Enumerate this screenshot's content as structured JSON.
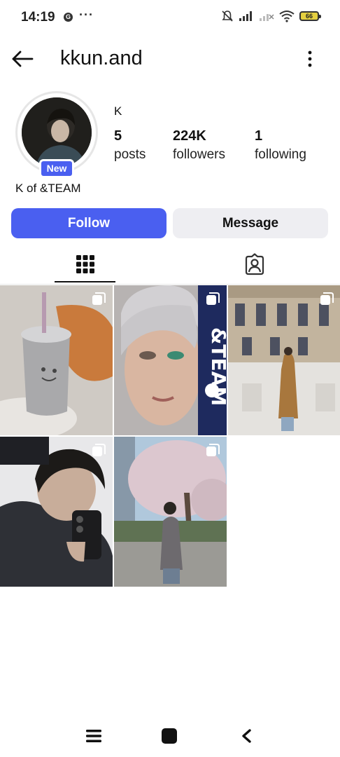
{
  "status_bar": {
    "time": "14:19",
    "notification_icon": "G",
    "more": "···",
    "battery": "66"
  },
  "header": {
    "username": "kkun.and"
  },
  "profile": {
    "display_name": "K",
    "new_badge": "New",
    "bio": "K of &TEAM",
    "stats": [
      {
        "value": "5",
        "label": "posts"
      },
      {
        "value": "224K",
        "label": "followers"
      },
      {
        "value": "1",
        "label": "following"
      }
    ]
  },
  "actions": {
    "follow_label": "Follow",
    "message_label": "Message"
  },
  "tabs": [
    {
      "icon": "grid-icon",
      "active": true
    },
    {
      "icon": "tagged-icon",
      "active": false
    }
  ],
  "colors": {
    "accent": "#4a5ff0",
    "secondary_button": "#eeeef2"
  },
  "posts": [
    {
      "name": "tumbler-post",
      "multi": true
    },
    {
      "name": "magazine-cover-post",
      "multi": true
    },
    {
      "name": "museum-post",
      "multi": true
    },
    {
      "name": "mirror-selfie-post",
      "multi": true
    },
    {
      "name": "cherry-blossom-post",
      "multi": true
    }
  ],
  "bottom_nav": [
    "menu-icon",
    "home-icon",
    "back-icon"
  ]
}
